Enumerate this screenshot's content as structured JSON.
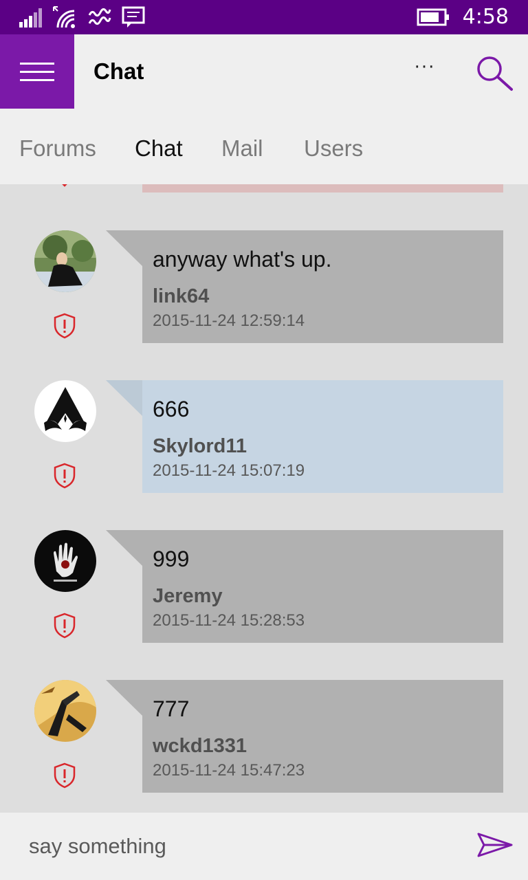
{
  "status_bar": {
    "time": "4:58",
    "icons": [
      "signal-icon",
      "wifi-icon",
      "vibrate-icon",
      "notification-icon",
      "battery-icon"
    ]
  },
  "app_bar": {
    "title": "Chat",
    "more_label": "···",
    "accent_color": "#7b19a8",
    "status_color": "#5b0085"
  },
  "tabs": [
    {
      "label": "Forums",
      "active": false
    },
    {
      "label": "Chat",
      "active": true
    },
    {
      "label": "Mail",
      "active": false
    },
    {
      "label": "Users",
      "active": false
    }
  ],
  "messages": [
    {
      "text": "anyway what's up.",
      "user": "link64",
      "timestamp": "2015-11-24 12:59:14",
      "style": "gray"
    },
    {
      "text": "666",
      "user": "Skylord11",
      "timestamp": "2015-11-24 15:07:19",
      "style": "blue"
    },
    {
      "text": "999",
      "user": "Jeremy",
      "timestamp": "2015-11-24 15:28:53",
      "style": "gray"
    },
    {
      "text": "777",
      "user": "wckd1331",
      "timestamp": "2015-11-24 15:47:23",
      "style": "gray"
    }
  ],
  "composer": {
    "placeholder": "say something",
    "value": ""
  }
}
